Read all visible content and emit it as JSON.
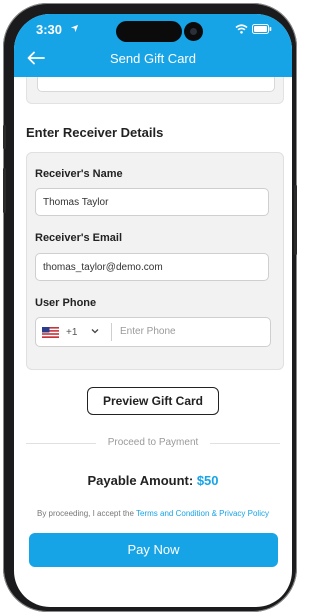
{
  "status_bar": {
    "time": "3:30"
  },
  "header": {
    "title": "Send Gift Card"
  },
  "section": {
    "title": "Enter Receiver Details"
  },
  "form": {
    "name_label": "Receiver's Name",
    "name_value": "Thomas Taylor",
    "email_label": "Receiver's Email",
    "email_value": "thomas_taylor@demo.com",
    "phone_label": "User Phone",
    "dial_code": "+1",
    "phone_placeholder": "Enter Phone"
  },
  "preview_button": {
    "label": "Preview Gift Card"
  },
  "proceed": {
    "label": "Proceed to Payment"
  },
  "payable": {
    "label": "Payable Amount:",
    "amount": "$50"
  },
  "terms": {
    "prefix": "By proceeding, I accept the ",
    "link": "Terms and Condition & Privacy Policy"
  },
  "pay_button": {
    "label": "Pay Now"
  },
  "colors": {
    "accent": "#17a4e7",
    "card_bg": "#f2f2f2"
  },
  "icons": [
    "location-arrow-icon",
    "wifi-icon",
    "battery-icon",
    "back-arrow-icon",
    "us-flag-icon",
    "chevron-down-icon"
  ]
}
